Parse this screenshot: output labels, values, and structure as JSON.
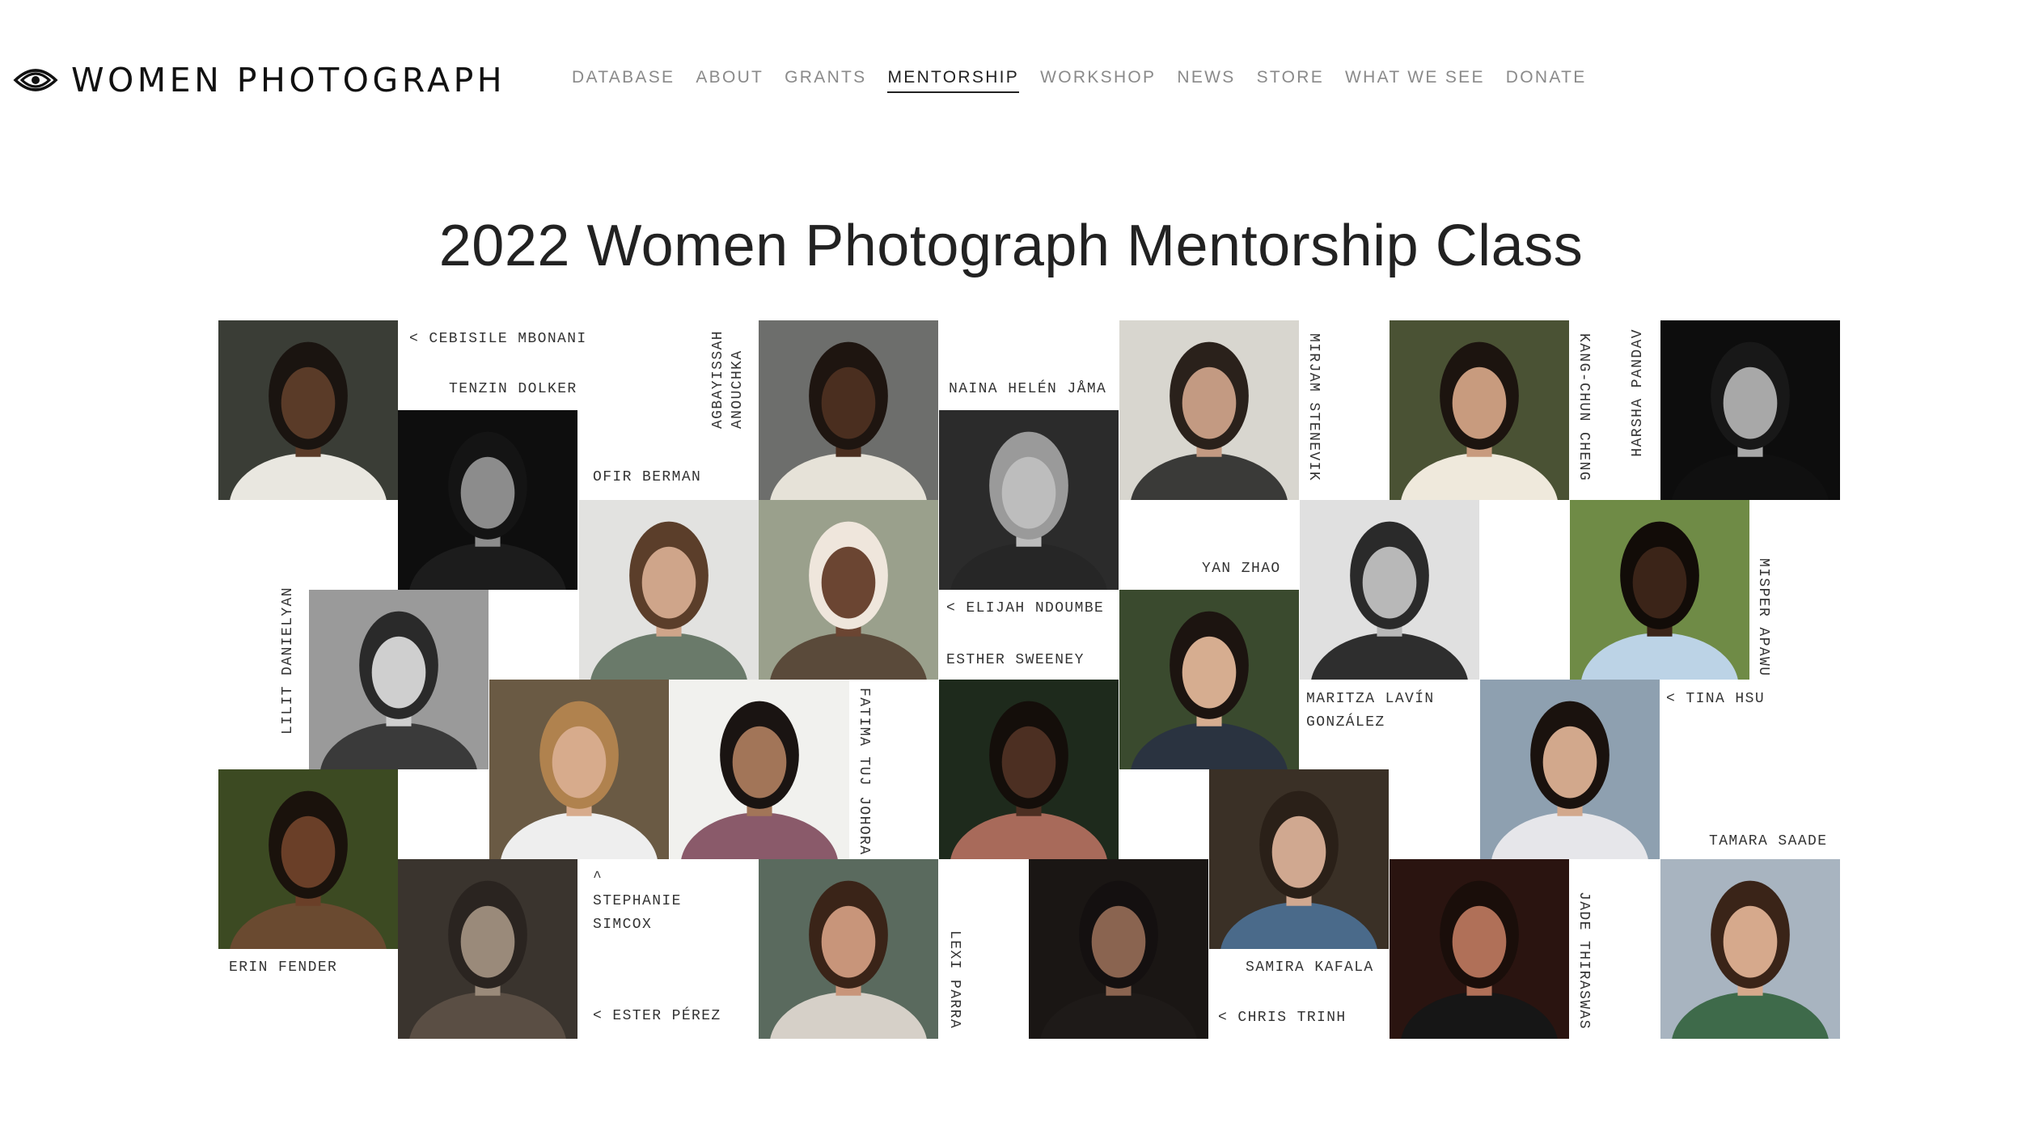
{
  "brand": {
    "name": "WOMEN PHOTOGRAPH",
    "logo_icon": "eye-logo-icon"
  },
  "nav": [
    {
      "label": "DATABASE",
      "active": false
    },
    {
      "label": "ABOUT",
      "active": false
    },
    {
      "label": "GRANTS",
      "active": false
    },
    {
      "label": "MENTORSHIP",
      "active": true
    },
    {
      "label": "WORKSHOP",
      "active": false
    },
    {
      "label": "NEWS",
      "active": false
    },
    {
      "label": "STORE",
      "active": false
    },
    {
      "label": "WHAT WE SEE",
      "active": false
    },
    {
      "label": "DONATE",
      "active": false
    }
  ],
  "page": {
    "title": "2022 Women Photograph Mentorship Class"
  },
  "captions": {
    "cebisile": "< CEBISILE MBONANI",
    "tenzin": "TENZIN DOLKER",
    "anouchka_1": "ANOUCHKA",
    "anouchka_2": "AGBAYISSAH",
    "ofir": "OFIR BERMAN",
    "naina": "NAINA HELÉN JÅMA",
    "mirjam": "MIRJAM STENEVIK",
    "kangchun": "KANG-CHUN CHENG",
    "harsha": "HARSHA PANDAV",
    "yan": "YAN ZHAO",
    "lilit": "LILIT DANIELYAN",
    "elijah": "< ELIJAH NDOUMBE",
    "esther": "ESTHER SWEENEY",
    "misper": "MISPER APAWU",
    "fatima": "FATIMA TUJ JOHORA",
    "maritza_1": "MARITZA LAVÍN",
    "maritza_2": "GONZÁLEZ",
    "tina": "< TINA HSU",
    "tamara": "TAMARA SAADE",
    "stephanie_0": "^",
    "stephanie_1": "STEPHANIE",
    "stephanie_2": "SIMCOX",
    "erin": "ERIN FENDER",
    "ester": "< ESTER PÉREZ",
    "lexi": "LEXI PARRA",
    "samira": "SAMIRA KAFALA",
    "chris": "< CHRIS TRINH",
    "jade": "JADE THIRASWAS"
  },
  "portraits": [
    {
      "id": "cebisile-mbonani",
      "bg": "#3a3d36",
      "skin": "#5a3b28",
      "hair": "#1a1410",
      "top": "#e9e7e0"
    },
    {
      "id": "tenzin-dolker",
      "bg": "#0e0e0e",
      "skin": "#8c8c8c",
      "hair": "#141414",
      "top": "#1c1c1c"
    },
    {
      "id": "anouchka-agbayissah",
      "bg": "#6d6e6c",
      "skin": "#4a2e1f",
      "hair": "#1e1510",
      "top": "#e6e2d8"
    },
    {
      "id": "naina-helen-jama",
      "bg": "#2b2b2b",
      "skin": "#bdbdbd",
      "hair": "#9a9a9a",
      "top": "#262626"
    },
    {
      "id": "mirjam-stenevik",
      "bg": "#d8d6cf",
      "skin": "#c39a82",
      "hair": "#2a211b",
      "top": "#3a3a38"
    },
    {
      "id": "kang-chun-cheng",
      "bg": "#4a5234",
      "skin": "#c89b7e",
      "hair": "#1c140f",
      "top": "#efe9dc"
    },
    {
      "id": "harsha-pandav",
      "bg": "#0d0d0d",
      "skin": "#a8a8a8",
      "hair": "#181818",
      "top": "#101010"
    },
    {
      "id": "ofir-berman",
      "bg": "#e2e2e0",
      "skin": "#cfa58a",
      "hair": "#5b3e2a",
      "top": "#6a7a6a"
    },
    {
      "id": "yan-zhao-elijah",
      "bg": "#9aa08c",
      "skin": "#6b4532",
      "hair": "#efe6dc",
      "top": "#5a4a3a"
    },
    {
      "id": "lilit-danielyan",
      "bg": "#9a9a9a",
      "skin": "#cfcfcf",
      "hair": "#2a2a2a",
      "top": "#3a3a3a"
    },
    {
      "id": "yan-zhao",
      "bg": "#e0e0e0",
      "skin": "#b8b8b8",
      "hair": "#2a2a2a",
      "top": "#2e2e2e"
    },
    {
      "id": "misper-apawu",
      "bg": "#6f8b46",
      "skin": "#3b2418",
      "hair": "#120c08",
      "top": "#bcd3e6"
    },
    {
      "id": "stephanie-simcox",
      "bg": "#6a5a44",
      "skin": "#d7ab8c",
      "hair": "#b0824e",
      "top": "#eeeeee"
    },
    {
      "id": "fatima-tuj-johora",
      "bg": "#f1f1ee",
      "skin": "#a27558",
      "hair": "#1a1412",
      "top": "#8a5a6a"
    },
    {
      "id": "esther-sweeney",
      "bg": "#1e2a1c",
      "skin": "#4c2f22",
      "hair": "#140e0a",
      "top": "#a86a5a"
    },
    {
      "id": "maritza-lavin",
      "bg": "#3a4a2e",
      "skin": "#d6ad90",
      "hair": "#1c1410",
      "top": "#2a3340"
    },
    {
      "id": "tina-hsu",
      "bg": "#8ea0b0",
      "skin": "#d2a88c",
      "hair": "#1a120e",
      "top": "#e6e6ea"
    },
    {
      "id": "erin-fender",
      "bg": "#3c4a22",
      "skin": "#6a3f28",
      "hair": "#1a120c",
      "top": "#6a4a30"
    },
    {
      "id": "samira-kafala",
      "bg": "#3a3026",
      "skin": "#d0a890",
      "hair": "#2a2018",
      "top": "#4a6a8a"
    },
    {
      "id": "stephanie-portrait",
      "bg": "#3a342e",
      "skin": "#9a8a7a",
      "hair": "#2a2420",
      "top": "#5a4e44"
    },
    {
      "id": "ester-perez",
      "bg": "#5a6a5e",
      "skin": "#c8957a",
      "hair": "#3a2418",
      "top": "#d6d0c8"
    },
    {
      "id": "chris-trinh",
      "bg": "#1a1614",
      "skin": "#8a6450",
      "hair": "#141010",
      "top": "#1e1a18"
    },
    {
      "id": "jade-thiraswas",
      "bg": "#2a1410",
      "skin": "#b07058",
      "hair": "#1a0e0a",
      "top": "#161616"
    },
    {
      "id": "tamara-saade",
      "bg": "#a8b4c0",
      "skin": "#d6a98c",
      "hair": "#3a2418",
      "top": "#3e6a4a"
    }
  ]
}
